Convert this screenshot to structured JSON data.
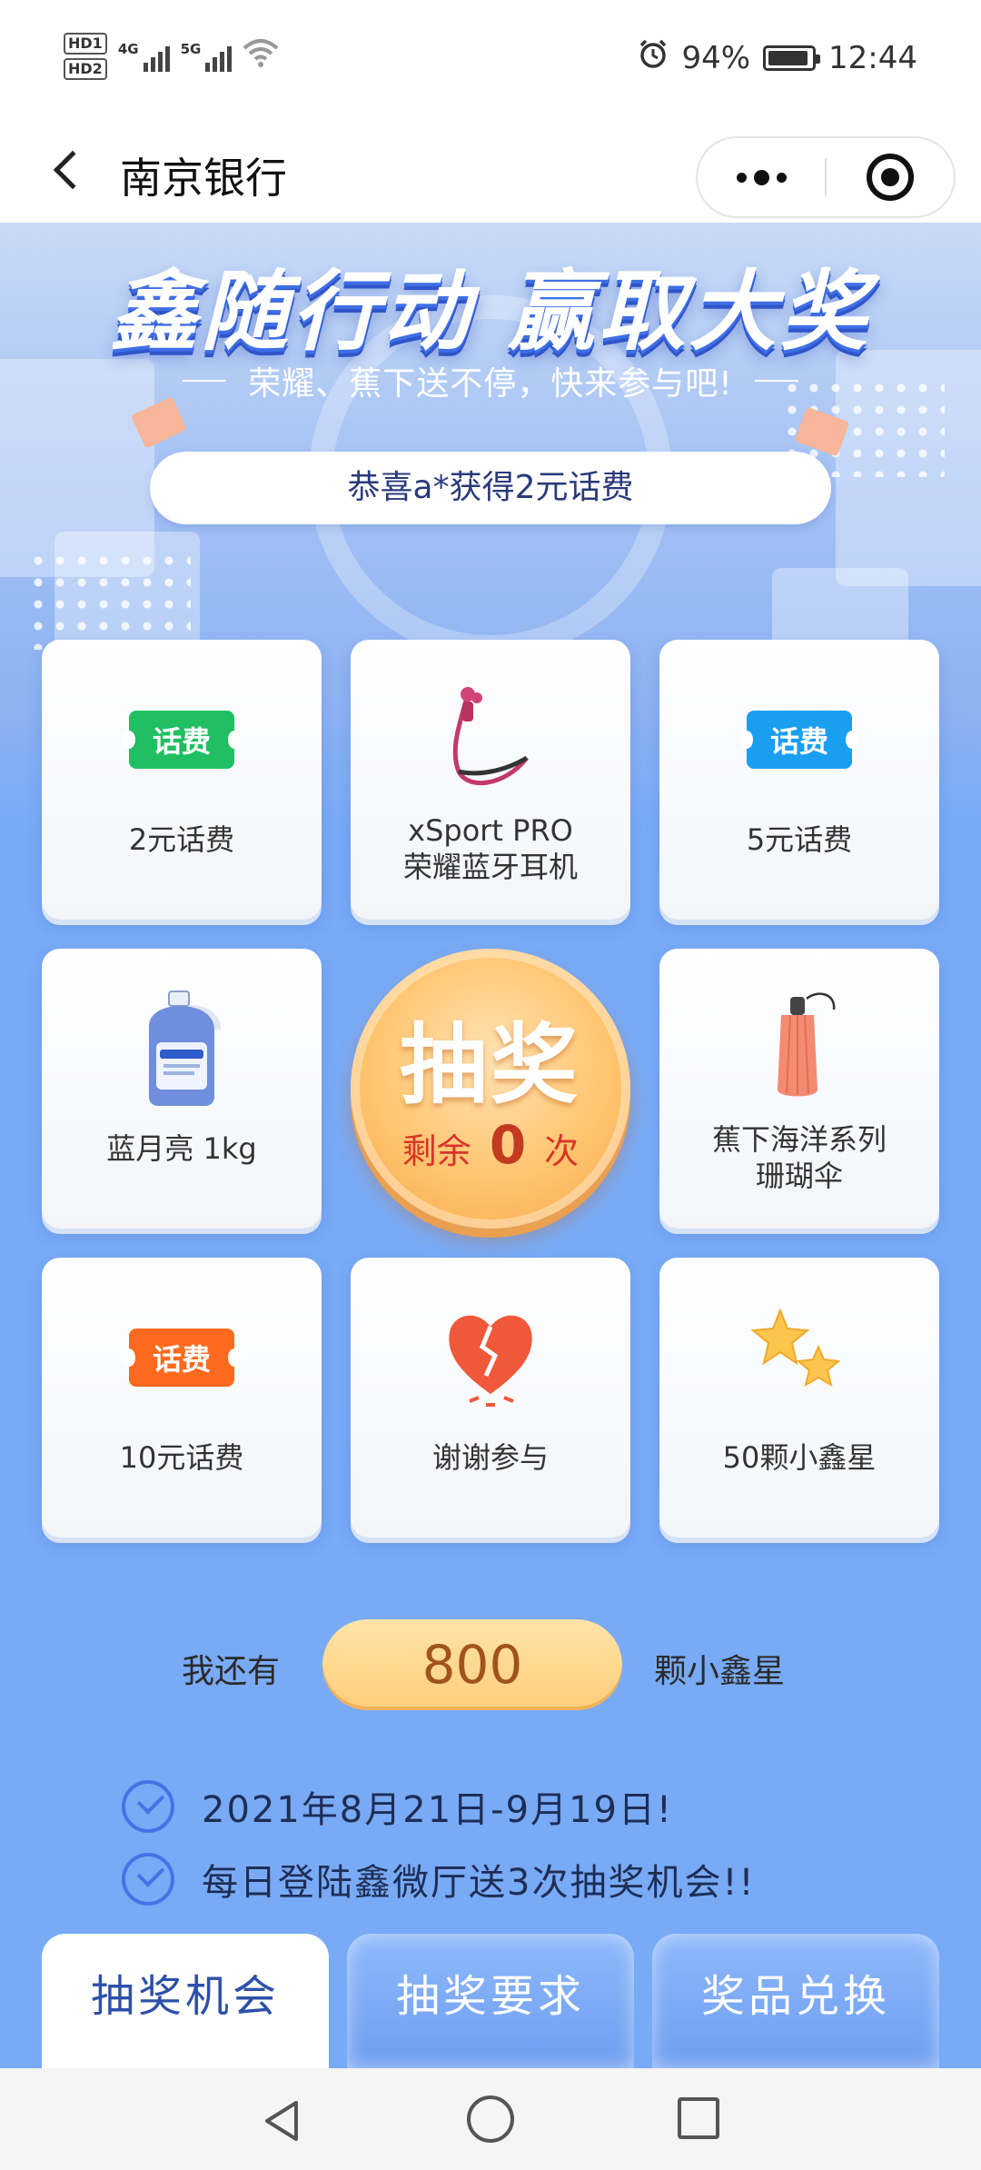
{
  "status_bar": {
    "hd1": "HD1",
    "hd2": "HD2",
    "net1": "4G",
    "net2": "5G",
    "battery_pct": "94%",
    "battery_level": 0.94,
    "time": "12:44"
  },
  "title_bar": {
    "title": "南京银行"
  },
  "banner": {
    "title": "鑫随行动 赢取大奖",
    "subtitle": "荣耀、蕉下送不停，快来参与吧!",
    "notice": "恭喜a*获得2元话费"
  },
  "fee_tag_text": "话费",
  "prizes": [
    {
      "label": "2元话费",
      "icon": "phone-fee-ticket-icon",
      "color": "#1fbf62"
    },
    {
      "label": "xSport PRO\n荣耀蓝牙耳机",
      "icon": "earphones-icon"
    },
    {
      "label": "5元话费",
      "icon": "phone-fee-ticket-icon",
      "color": "#1a9ef0"
    },
    {
      "label": "蓝月亮 1kg",
      "icon": "detergent-bottle-icon"
    },
    {
      "label": "蕉下海洋系列\n珊瑚伞",
      "icon": "umbrella-icon"
    },
    {
      "label": "10元话费",
      "icon": "phone-fee-ticket-icon",
      "color": "#fb6a1e"
    },
    {
      "label": "谢谢参与",
      "icon": "broken-heart-icon"
    },
    {
      "label": "50颗小鑫星",
      "icon": "stars-icon"
    }
  ],
  "draw": {
    "title": "抽奖",
    "remaining_prefix": "剩余",
    "remaining": "0",
    "remaining_suffix": "次"
  },
  "points": {
    "prefix": "我还有",
    "value": "800",
    "suffix": "颗小鑫星"
  },
  "rules": [
    "2021年8月21日-9月19日!",
    "每日登陆鑫微厅送3次抽奖机会!!"
  ],
  "tabs": [
    {
      "label": "抽奖机会",
      "active": true
    },
    {
      "label": "抽奖要求",
      "active": false
    },
    {
      "label": "奖品兑换",
      "active": false
    }
  ]
}
